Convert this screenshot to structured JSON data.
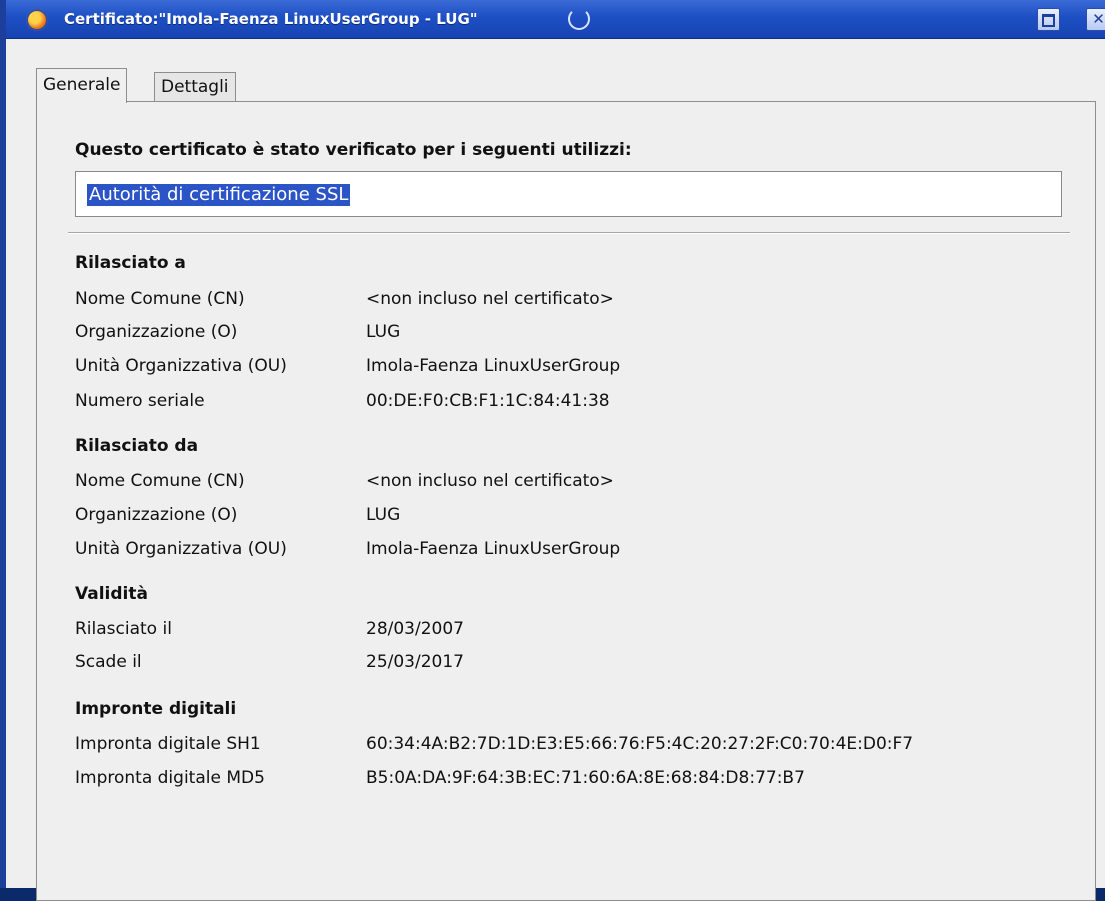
{
  "window": {
    "title": "Certificato:\"Imola-Faenza LinuxUserGroup - LUG\""
  },
  "tabs": [
    {
      "label": "Generale",
      "active": true
    },
    {
      "label": "Dettagli",
      "active": false
    }
  ],
  "verified": {
    "heading": "Questo certificato è stato verificato per i seguenti utilizzi:",
    "usage": "Autorità di certificazione SSL"
  },
  "issued_to": {
    "title": "Rilasciato a",
    "rows": [
      {
        "label": "Nome Comune (CN)",
        "value": "<non incluso nel certificato>"
      },
      {
        "label": "Organizzazione (O)",
        "value": "LUG"
      },
      {
        "label": "Unità Organizzativa (OU)",
        "value": "Imola-Faenza LinuxUserGroup"
      },
      {
        "label": "Numero seriale",
        "value": "00:DE:F0:CB:F1:1C:84:41:38"
      }
    ]
  },
  "issued_by": {
    "title": "Rilasciato da",
    "rows": [
      {
        "label": "Nome Comune (CN)",
        "value": "<non incluso nel certificato>"
      },
      {
        "label": "Organizzazione (O)",
        "value": "LUG"
      },
      {
        "label": "Unità Organizzativa (OU)",
        "value": "Imola-Faenza LinuxUserGroup"
      }
    ]
  },
  "validity": {
    "title": "Validità",
    "rows": [
      {
        "label": "Rilasciato il",
        "value": "28/03/2007"
      },
      {
        "label": "Scade il",
        "value": "25/03/2017"
      }
    ]
  },
  "fingerprints": {
    "title": "Impronte digitali",
    "rows": [
      {
        "label": "Impronta digitale SH1",
        "value": "60:34:4A:B2:7D:1D:E3:E5:66:76:F5:4C:20:27:2F:C0:70:4E:D0:F7"
      },
      {
        "label": "Impronta digitale MD5",
        "value": "B5:0A:DA:9F:64:3B:EC:71:60:6A:8E:68:84:D8:77:B7"
      }
    ]
  }
}
